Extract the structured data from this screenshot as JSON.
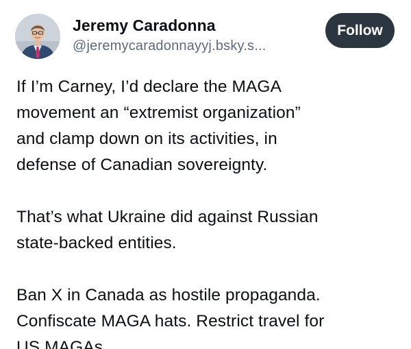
{
  "author": {
    "name": "Jeremy Caradonna",
    "handle": "@jeremycaradonnayyj.bsky.s...",
    "avatar_icon": "profile-photo"
  },
  "follow_button": {
    "label": "Follow"
  },
  "post": {
    "paragraphs": [
      "If I’m Carney, I’d declare the MAGA\nmovement an “extremist organization”\nand clamp down on its activities, in\ndefense of Canadian sovereignty.",
      "That’s what Ukraine did against Russian\nstate-backed entities.",
      "Ban X in Canada as hostile propaganda.\nConfiscate MAGA hats. Restrict travel for\nUS MAGAs"
    ]
  },
  "colors": {
    "follow_bg": "#2b3641",
    "handle": "#5b6b7c",
    "text": "#0b0f14"
  }
}
